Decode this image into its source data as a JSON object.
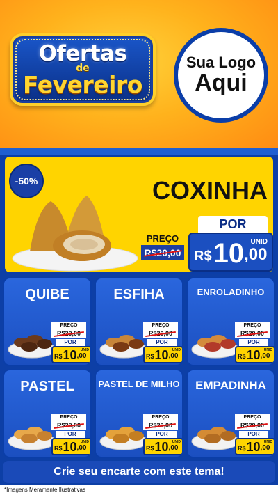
{
  "header": {
    "brand_line1": "Ofertas",
    "brand_line2": "de",
    "brand_line3": "Fevereiro",
    "logo_line1": "Sua Logo",
    "logo_line2": "Aqui"
  },
  "featured": {
    "discount": "-50%",
    "name": "COXINHA",
    "preco_label": "PREÇO",
    "old_price": "R$20,00",
    "por_label": "POR",
    "currency": "R$",
    "price_int": "10",
    "price_dec": ",00",
    "unit": "UNID"
  },
  "products": [
    {
      "name": "QUIBE",
      "preco_label": "PREÇO",
      "old_price": "R$20,00",
      "por_label": "POR",
      "currency": "R$",
      "price_int": "10",
      "price_dec": ",00",
      "unit": "UNID"
    },
    {
      "name": "ESFIHA",
      "preco_label": "PREÇO",
      "old_price": "R$20,00",
      "por_label": "POR",
      "currency": "R$",
      "price_int": "10",
      "price_dec": ",00",
      "unit": "UNID"
    },
    {
      "name": "ENROLADINHO",
      "preco_label": "PREÇO",
      "old_price": "R$20,00",
      "por_label": "POR",
      "currency": "R$",
      "price_int": "10",
      "price_dec": ",00",
      "unit": "UNID"
    },
    {
      "name": "PASTEL",
      "preco_label": "PREÇO",
      "old_price": "R$20,00",
      "por_label": "POR",
      "currency": "R$",
      "price_int": "10",
      "price_dec": ",00",
      "unit": "UNID"
    },
    {
      "name": "PASTEL DE MILHO",
      "preco_label": "PREÇO",
      "old_price": "R$20,00",
      "por_label": "POR",
      "currency": "R$",
      "price_int": "10",
      "price_dec": ",00",
      "unit": "UNID"
    },
    {
      "name": "EMPADINHA",
      "preco_label": "PREÇO",
      "old_price": "R$20,00",
      "por_label": "POR",
      "currency": "R$",
      "price_int": "10",
      "price_dec": ",00",
      "unit": "UNID"
    }
  ],
  "footer": {
    "cta": "Crie seu encarte com este tema!",
    "note": "*Imagens Meramente Ilustrativas"
  },
  "colors": {
    "blue": "#1b4fc0",
    "yellow": "#ffd400",
    "orange": "#ff8a12"
  }
}
